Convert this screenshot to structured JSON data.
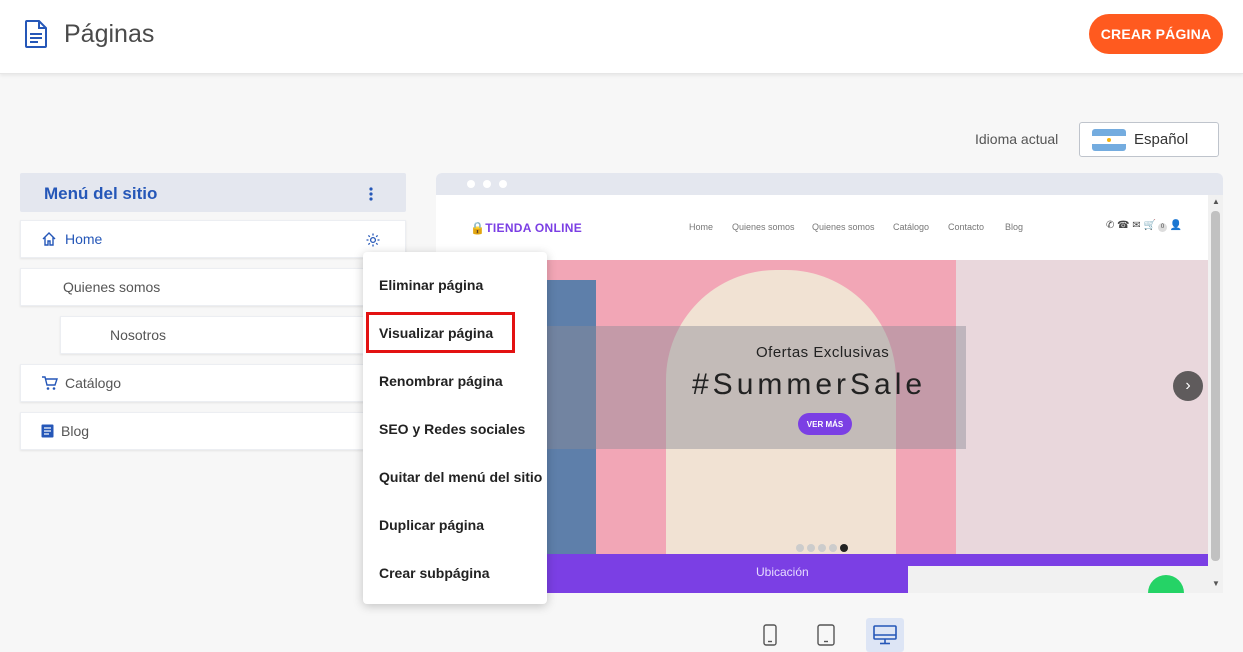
{
  "header": {
    "title": "Páginas",
    "create_button": "CREAR PÁGINA"
  },
  "language": {
    "label": "Idioma actual",
    "selected": "Español",
    "flag": "argentina-flag"
  },
  "site_menu": {
    "title": "Menú del sitio",
    "items": [
      {
        "label": "Home",
        "icon": "home-icon"
      },
      {
        "label": "Quienes somos"
      },
      {
        "label": "Nosotros"
      },
      {
        "label": "Catálogo",
        "icon": "cart-icon"
      },
      {
        "label": "Blog",
        "icon": "document-icon"
      }
    ]
  },
  "context_menu": {
    "items": [
      "Eliminar página",
      "Visualizar página",
      "Renombrar página",
      "SEO y Redes sociales",
      "Quitar del menú del sitio",
      "Duplicar página",
      "Crear subpágina"
    ],
    "highlighted": "Visualizar página"
  },
  "preview": {
    "logo": "TIENDA ONLINE",
    "nav": [
      "Home",
      "Quienes somos",
      "Quienes somos",
      "Catálogo",
      "Contacto",
      "Blog"
    ],
    "cart_count": "0",
    "hero_subtitle": "Ofertas Exclusivas",
    "hero_title": "#SummerSale",
    "hero_button": "VER MÁS",
    "footer_heading": "Ubicación"
  },
  "device_buttons": [
    "mobile-icon",
    "tablet-icon",
    "desktop-icon"
  ],
  "colors": {
    "accent": "#ff5a1f",
    "primary_blue": "#2557b8",
    "brand_purple": "#7b3fe4",
    "highlight_red": "#e31212"
  }
}
